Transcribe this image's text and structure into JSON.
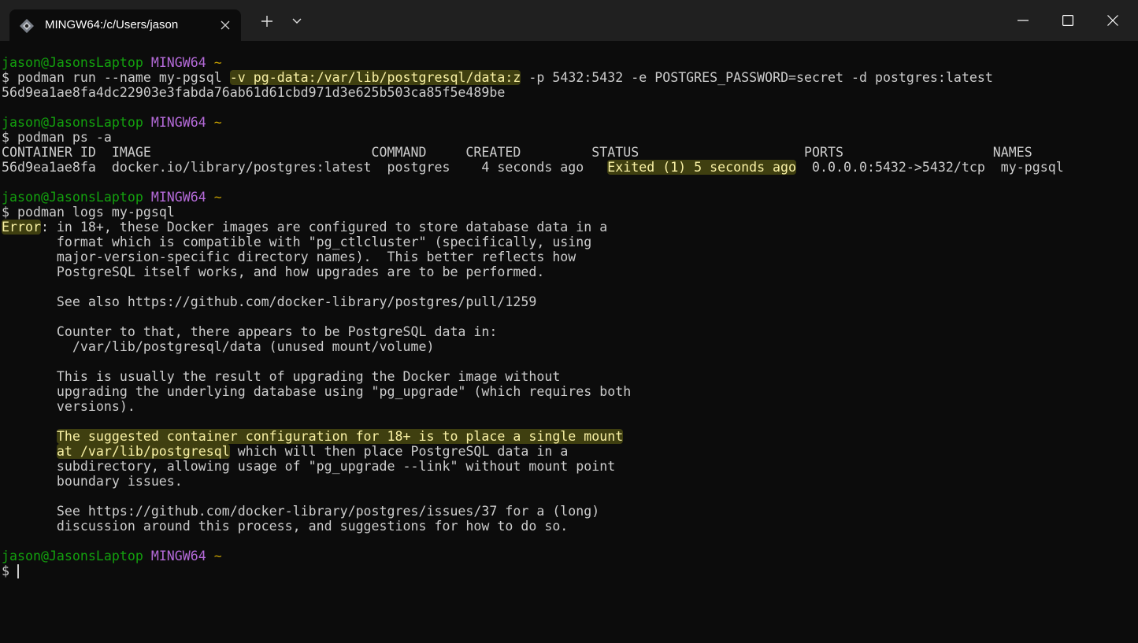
{
  "tab": {
    "title": "MINGW64:/c/Users/jason",
    "icon": "git-bash-icon",
    "accent": "#3f9ae0"
  },
  "titlebar": {
    "new_tab": "+",
    "dropdown_icon": "chevron-down-icon",
    "minimize_icon": "minimize-icon",
    "maximize_icon": "maximize-icon",
    "close_icon": "close-icon"
  },
  "colors": {
    "background": "#0c0c0c",
    "text": "#cccccc",
    "user": "#13a10e",
    "host": "#b46ad8",
    "tilde": "#c19c00",
    "error": "#f9f1a5",
    "highlight": "#f5f51e"
  },
  "prompt": {
    "user": "jason@JasonsLaptop",
    "host": "MINGW64",
    "path": "~",
    "symbol": "$"
  },
  "commands": {
    "run_pre": "podman run --name my-pgsql ",
    "run_hl": "-v pg-data:/var/lib/postgresql/data:z",
    "run_post": " -p 5432:5432 -e POSTGRES_PASSWORD=secret -d postgres:latest",
    "run_output": "56d9ea1ae8fa4dc22903e3fabda76ab61d61cbd971d3e625b503ca85f5e489be",
    "ps": "podman ps -a",
    "logs": "podman logs my-pgsql"
  },
  "ps_table": {
    "header_a": "CONTAINER ID  IMAGE                            COMMAND     CREATED         ",
    "header_b": "STATUS                     PORTS                   NAMES",
    "row_a": "56d9ea1ae8fa  docker.io/library/postgres:latest  postgres    4 seconds ago   ",
    "row_status": "Exited (1) 5 seconds ago",
    "row_b": "  0.0.0.0:5432->5432/tcp  my-pgsql"
  },
  "logs": {
    "error_label": "Error",
    "l1": ": in 18+, these Docker images are configured to store database data in a",
    "l2": "       format which is compatible with \"pg_ctlcluster\" (specifically, using",
    "l3": "       major-version-specific directory names).  This better reflects how",
    "l4": "       PostgreSQL itself works, and how upgrades are to be performed.",
    "l5": "       See also https://github.com/docker-library/postgres/pull/1259",
    "l6": "       Counter to that, there appears to be PostgreSQL data in:",
    "l7": "         /var/lib/postgresql/data (unused mount/volume)",
    "l8": "       This is usually the result of upgrading the Docker image without",
    "l9": "       upgrading the underlying database using \"pg_upgrade\" (which requires both",
    "l10": "       versions).",
    "l11_indent": "       ",
    "l11_hl": "The suggested container configuration for 18+ is to place a single mount",
    "l12_hl": "at /var/lib/postgresql",
    "l12_post": " which will then place PostgreSQL data in a",
    "l13": "       subdirectory, allowing usage of \"pg_upgrade --link\" without mount point",
    "l14": "       boundary issues.",
    "l15": "       See https://github.com/docker-library/postgres/issues/37 for a (long)",
    "l16": "       discussion around this process, and suggestions for how to do so."
  }
}
